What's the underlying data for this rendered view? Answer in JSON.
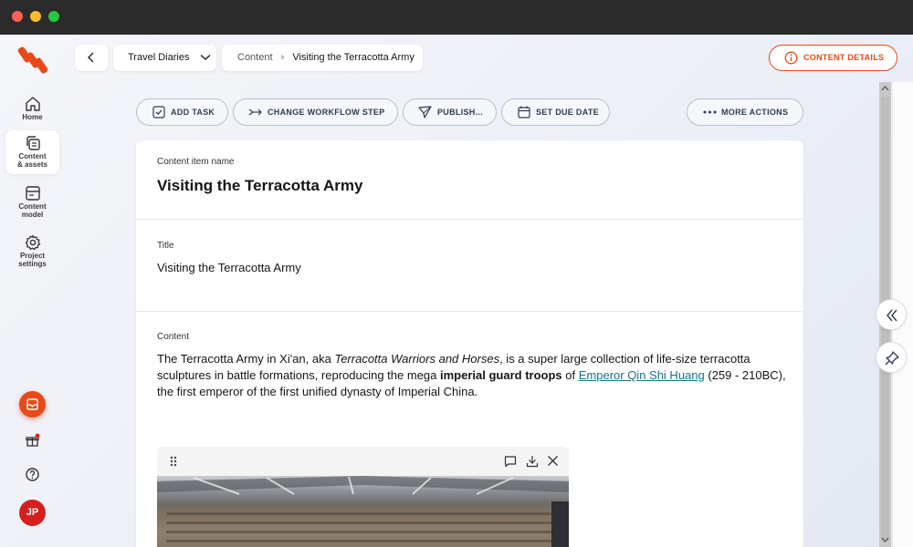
{
  "sidebar": {
    "items": [
      {
        "label": "Home",
        "icon": "home-icon"
      },
      {
        "label": "Content\n& assets",
        "icon": "content-assets-icon",
        "active": true
      },
      {
        "label": "Content\nmodel",
        "icon": "content-model-icon"
      },
      {
        "label": "Project\nsettings",
        "icon": "gear-icon"
      }
    ],
    "avatar_initials": "JP"
  },
  "topbar": {
    "project": "Travel Diaries",
    "breadcrumb": {
      "section": "Content",
      "item": "Visiting the Terracotta Army"
    },
    "details_label": "CONTENT DETAILS"
  },
  "actions": {
    "add_task": "ADD TASK",
    "change_workflow": "CHANGE WORKFLOW STEP",
    "publish": "PUBLISH...",
    "due_date": "SET DUE DATE",
    "more": "MORE ACTIONS"
  },
  "editor": {
    "item_name_label": "Content item name",
    "item_name": "Visiting the Terracotta Army",
    "title_label": "Title",
    "title_value": "Visiting the Terracotta Army",
    "content_label": "Content",
    "content": {
      "t1": "The Terracotta Army in Xi'an, aka ",
      "t2": "Terracotta Warriors and Horses",
      "t3": ", is a super large collection of life-size terracotta sculptures in battle formations, reproducing the mega ",
      "t4": "imperial guard troops",
      "t5": " of ",
      "link": "Emperor Qin Shi Huang",
      "t6": " (259 - 210BC), the first emperor of the first unified dynasty of Imperial China."
    }
  },
  "colors": {
    "accent": "#e64a19",
    "link": "#1c6e8c"
  }
}
